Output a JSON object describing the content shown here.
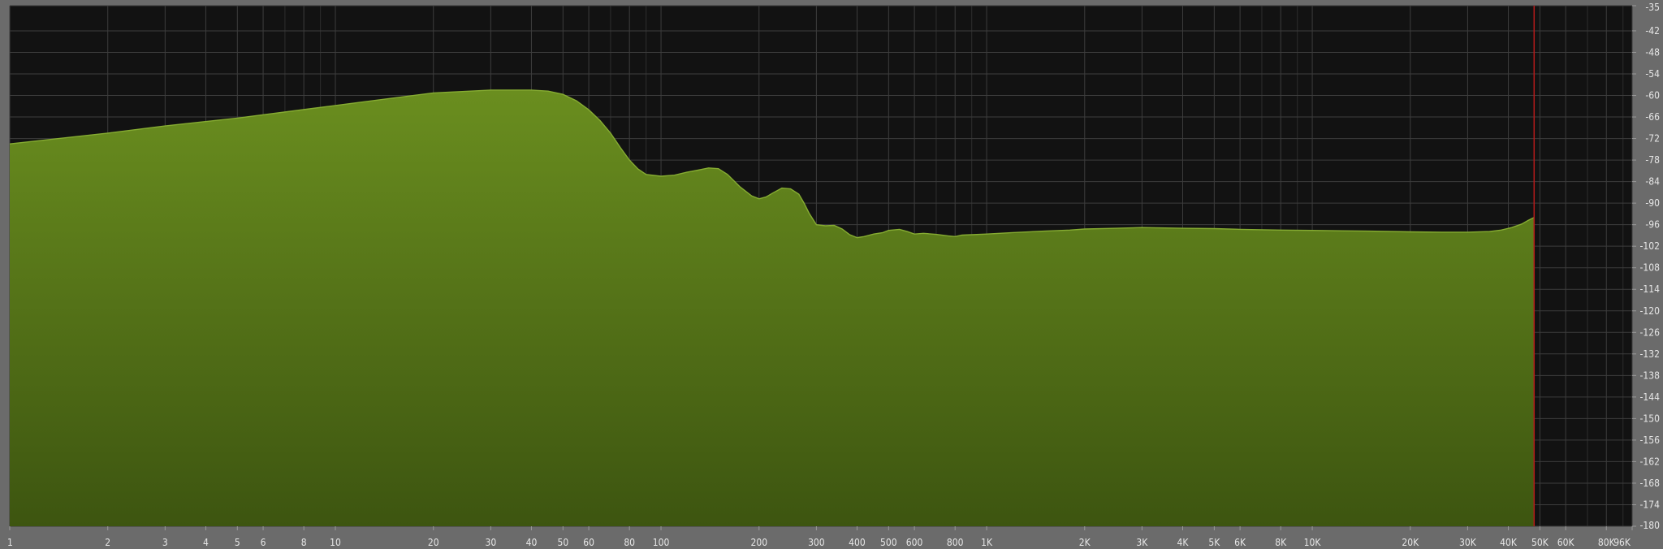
{
  "chart_data": {
    "type": "area",
    "title": "",
    "xlabel": "",
    "ylabel": "",
    "x_scale": "log",
    "xlim": [
      1,
      96000
    ],
    "ylim": [
      -180,
      -35
    ],
    "grid": true,
    "x_tick_labels": [
      {
        "value": 1,
        "label": "1"
      },
      {
        "value": 2,
        "label": "2"
      },
      {
        "value": 3,
        "label": "3"
      },
      {
        "value": 4,
        "label": "4"
      },
      {
        "value": 5,
        "label": "5"
      },
      {
        "value": 6,
        "label": "6"
      },
      {
        "value": 8,
        "label": "8"
      },
      {
        "value": 10,
        "label": "10"
      },
      {
        "value": 20,
        "label": "20"
      },
      {
        "value": 30,
        "label": "30"
      },
      {
        "value": 40,
        "label": "40"
      },
      {
        "value": 50,
        "label": "50"
      },
      {
        "value": 60,
        "label": "60"
      },
      {
        "value": 80,
        "label": "80"
      },
      {
        "value": 100,
        "label": "100"
      },
      {
        "value": 200,
        "label": "200"
      },
      {
        "value": 300,
        "label": "300"
      },
      {
        "value": 400,
        "label": "400"
      },
      {
        "value": 500,
        "label": "500"
      },
      {
        "value": 600,
        "label": "600"
      },
      {
        "value": 800,
        "label": "800"
      },
      {
        "value": 1000,
        "label": "1K"
      },
      {
        "value": 2000,
        "label": "2K"
      },
      {
        "value": 3000,
        "label": "3K"
      },
      {
        "value": 4000,
        "label": "4K"
      },
      {
        "value": 5000,
        "label": "5K"
      },
      {
        "value": 6000,
        "label": "6K"
      },
      {
        "value": 8000,
        "label": "8K"
      },
      {
        "value": 10000,
        "label": "10K"
      },
      {
        "value": 20000,
        "label": "20K"
      },
      {
        "value": 30000,
        "label": "30K"
      },
      {
        "value": 40000,
        "label": "40K"
      },
      {
        "value": 50000,
        "label": "50K"
      },
      {
        "value": 60000,
        "label": "60K"
      },
      {
        "value": 80000,
        "label": "80K"
      },
      {
        "value": 96000,
        "label": "96K"
      }
    ],
    "x_minor_gridlines": [
      7,
      9,
      70,
      90,
      700,
      900,
      7000,
      9000,
      70000,
      90000
    ],
    "y_tick_labels": [
      {
        "value": -35,
        "label": "-35"
      },
      {
        "value": -42,
        "label": "-42"
      },
      {
        "value": -48,
        "label": "-48"
      },
      {
        "value": -54,
        "label": "-54"
      },
      {
        "value": -60,
        "label": "-60"
      },
      {
        "value": -66,
        "label": "-66"
      },
      {
        "value": -72,
        "label": "-72"
      },
      {
        "value": -78,
        "label": "-78"
      },
      {
        "value": -84,
        "label": "-84"
      },
      {
        "value": -90,
        "label": "-90"
      },
      {
        "value": -96,
        "label": "-96"
      },
      {
        "value": -102,
        "label": "-102"
      },
      {
        "value": -108,
        "label": "-108"
      },
      {
        "value": -114,
        "label": "-114"
      },
      {
        "value": -120,
        "label": "-120"
      },
      {
        "value": -126,
        "label": "-126"
      },
      {
        "value": -132,
        "label": "-132"
      },
      {
        "value": -138,
        "label": "-138"
      },
      {
        "value": -144,
        "label": "-144"
      },
      {
        "value": -150,
        "label": "-150"
      },
      {
        "value": -156,
        "label": "-156"
      },
      {
        "value": -162,
        "label": "-162"
      },
      {
        "value": -168,
        "label": "-168"
      },
      {
        "value": -174,
        "label": "-174"
      },
      {
        "value": -180,
        "label": "-180"
      }
    ],
    "series": [
      {
        "x": [
          1,
          2,
          3,
          5,
          10,
          20,
          30,
          40,
          45,
          50,
          55,
          60,
          65,
          70,
          75,
          80,
          85,
          90,
          100,
          110,
          120,
          130,
          140,
          150,
          160,
          175,
          190,
          200,
          210,
          220,
          235,
          250,
          265,
          275,
          285,
          300,
          320,
          340,
          360,
          380,
          400,
          420,
          450,
          480,
          500,
          540,
          570,
          600,
          640,
          700,
          760,
          800,
          840,
          900,
          1000,
          1200,
          1500,
          1800,
          2000,
          2500,
          3000,
          4000,
          5000,
          6000,
          8000,
          10000,
          15000,
          20000,
          25000,
          30000,
          35000,
          38000,
          41000,
          44000,
          46000,
          48000
        ],
        "y": [
          -73.5,
          -70.5,
          -68.5,
          -66.3,
          -62.8,
          -59.3,
          -58.5,
          -58.5,
          -58.8,
          -59.7,
          -61.5,
          -64,
          -67,
          -70.5,
          -74.5,
          -78,
          -80.5,
          -82,
          -82.5,
          -82.2,
          -81.4,
          -80.8,
          -80.2,
          -80.4,
          -82,
          -85.5,
          -88,
          -88.8,
          -88.3,
          -87.2,
          -85.8,
          -86,
          -87.5,
          -90,
          -92.8,
          -96,
          -96.3,
          -96.2,
          -97.2,
          -98.8,
          -99.6,
          -99.3,
          -98.6,
          -98.2,
          -97.6,
          -97.3,
          -97.9,
          -98.6,
          -98.4,
          -98.7,
          -99.1,
          -99.3,
          -98.9,
          -98.8,
          -98.6,
          -98.2,
          -97.8,
          -97.5,
          -97.2,
          -97,
          -96.8,
          -97,
          -97.1,
          -97.3,
          -97.5,
          -97.6,
          -97.8,
          -98,
          -98.1,
          -98.1,
          -97.9,
          -97.5,
          -96.8,
          -95.8,
          -94.8,
          -94
        ]
      }
    ],
    "marker_line": {
      "x": 48000,
      "color": "#b31a1a"
    },
    "colors": {
      "plot_background": "#121212",
      "frame": "#6b6b6b",
      "grid": "#3d3d3d",
      "grid_minor": "#2e2e2e",
      "fill_top": "#6a8e1f",
      "fill_bottom": "#3d5510",
      "outline": "#86ac32",
      "tick_label": "#e6e6e6"
    }
  }
}
